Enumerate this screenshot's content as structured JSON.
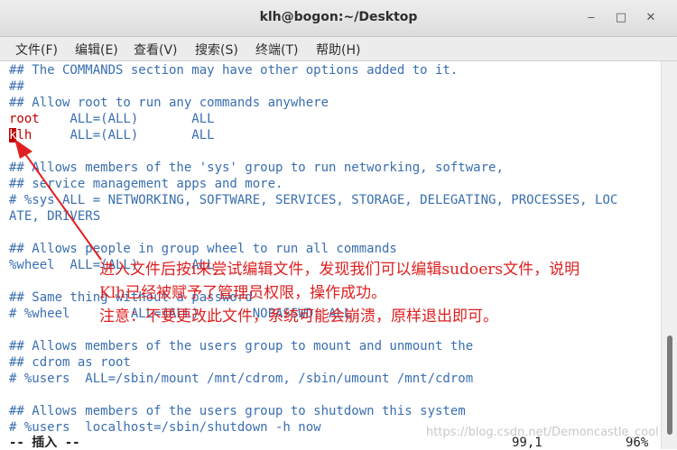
{
  "window": {
    "title": "klh@bogon:~/Desktop",
    "min": "‒",
    "max": "□",
    "close": "✕"
  },
  "menu": [
    "文件(F)",
    "编辑(E)",
    "查看(V)",
    "搜索(S)",
    "终端(T)",
    "帮助(H)"
  ],
  "lines": {
    "l1": "## The COMMANDS section may have other options added to it.",
    "l2": "##",
    "l3": "## Allow root to run any commands anywhere",
    "l4_user": "root",
    "l4_rest": "    ALL=(ALL)       ALL",
    "l5_cursor": "k",
    "l5_user": "lh",
    "l5_rest": "     ALL=(ALL)       ALL",
    "l7": "## Allows members of the 'sys' group to run networking, software,",
    "l8": "## service management apps and more.",
    "l9": "# %sys ALL = NETWORKING, SOFTWARE, SERVICES, STORAGE, DELEGATING, PROCESSES, LOC",
    "l10": "ATE, DRIVERS",
    "l12": "## Allows people in group wheel to run all commands",
    "l13": "%wheel  ALL=(ALL)       ALL",
    "l15": "## Same thing without a password",
    "l16": "# %wheel        ALL=(ALL)       NOPASSWD: ALL",
    "l18": "## Allows members of the users group to mount and unmount the",
    "l19": "## cdrom as root",
    "l20": "# %users  ALL=/sbin/mount /mnt/cdrom, /sbin/umount /mnt/cdrom",
    "l22": "## Allows members of the users group to shutdown this system",
    "l23": "# %users  localhost=/sbin/shutdown -h now"
  },
  "status": {
    "mode": "-- 插入 --",
    "position": "99,1",
    "percent": "96%"
  },
  "annotation": {
    "line1": "进入文件后按i来尝试编辑文件，发现我们可以编辑sudoers文件，说明",
    "line2": "Klh已经被赋予了管理员权限，操作成功。",
    "line3": "注意：不要更改此文件，系统可能会崩溃，原样退出即可。"
  },
  "watermark": "https://blog.csdn.net/Demoncastle_cool",
  "colors": {
    "annotation": "#e02020",
    "comment": "#3a6fb0",
    "cursor": "#c00000"
  }
}
